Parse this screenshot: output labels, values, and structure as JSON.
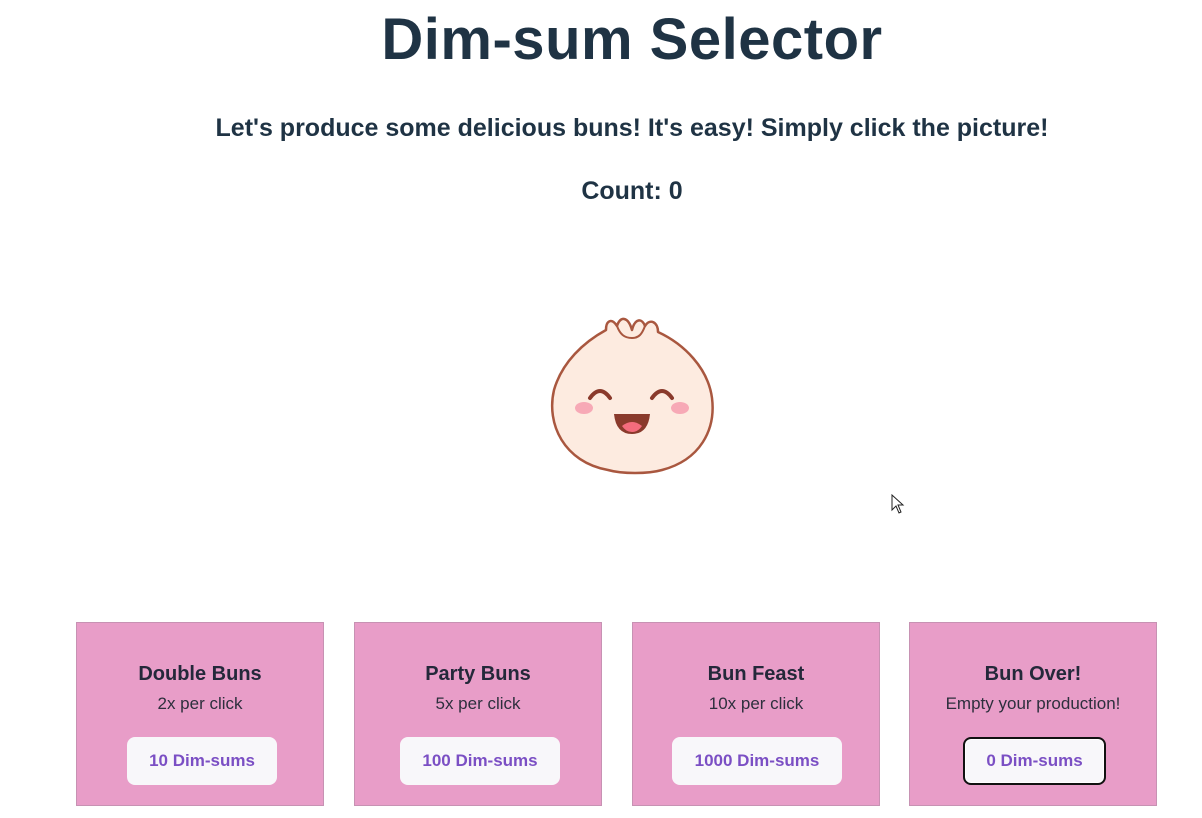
{
  "header": {
    "title": "Dim-sum Selector",
    "subtitle": "Let's produce some delicious buns! It's easy! Simply click the picture!",
    "count_label": "Count: 0"
  },
  "bun": {
    "icon": "dimsum-bun-icon",
    "colors": {
      "dough": "#fdebe0",
      "outline": "#a9573f",
      "blush": "#f7a9b6",
      "mouth": "#8a3a2c",
      "tongue": "#f36c7d"
    }
  },
  "colors": {
    "card_bg": "#e89dc8",
    "title_text": "#1f3344",
    "button_text": "#7b4fc4",
    "button_bg": "#f8f7fa"
  },
  "upgrades": [
    {
      "title": "Double Buns",
      "description": "2x per click",
      "button_label": "10 Dim-sums"
    },
    {
      "title": "Party Buns",
      "description": "5x per click",
      "button_label": "100 Dim-sums"
    },
    {
      "title": "Bun Feast",
      "description": "10x per click",
      "button_label": "1000 Dim-sums"
    },
    {
      "title": "Bun Over!",
      "description": "Empty your production!",
      "button_label": "0 Dim-sums"
    }
  ]
}
